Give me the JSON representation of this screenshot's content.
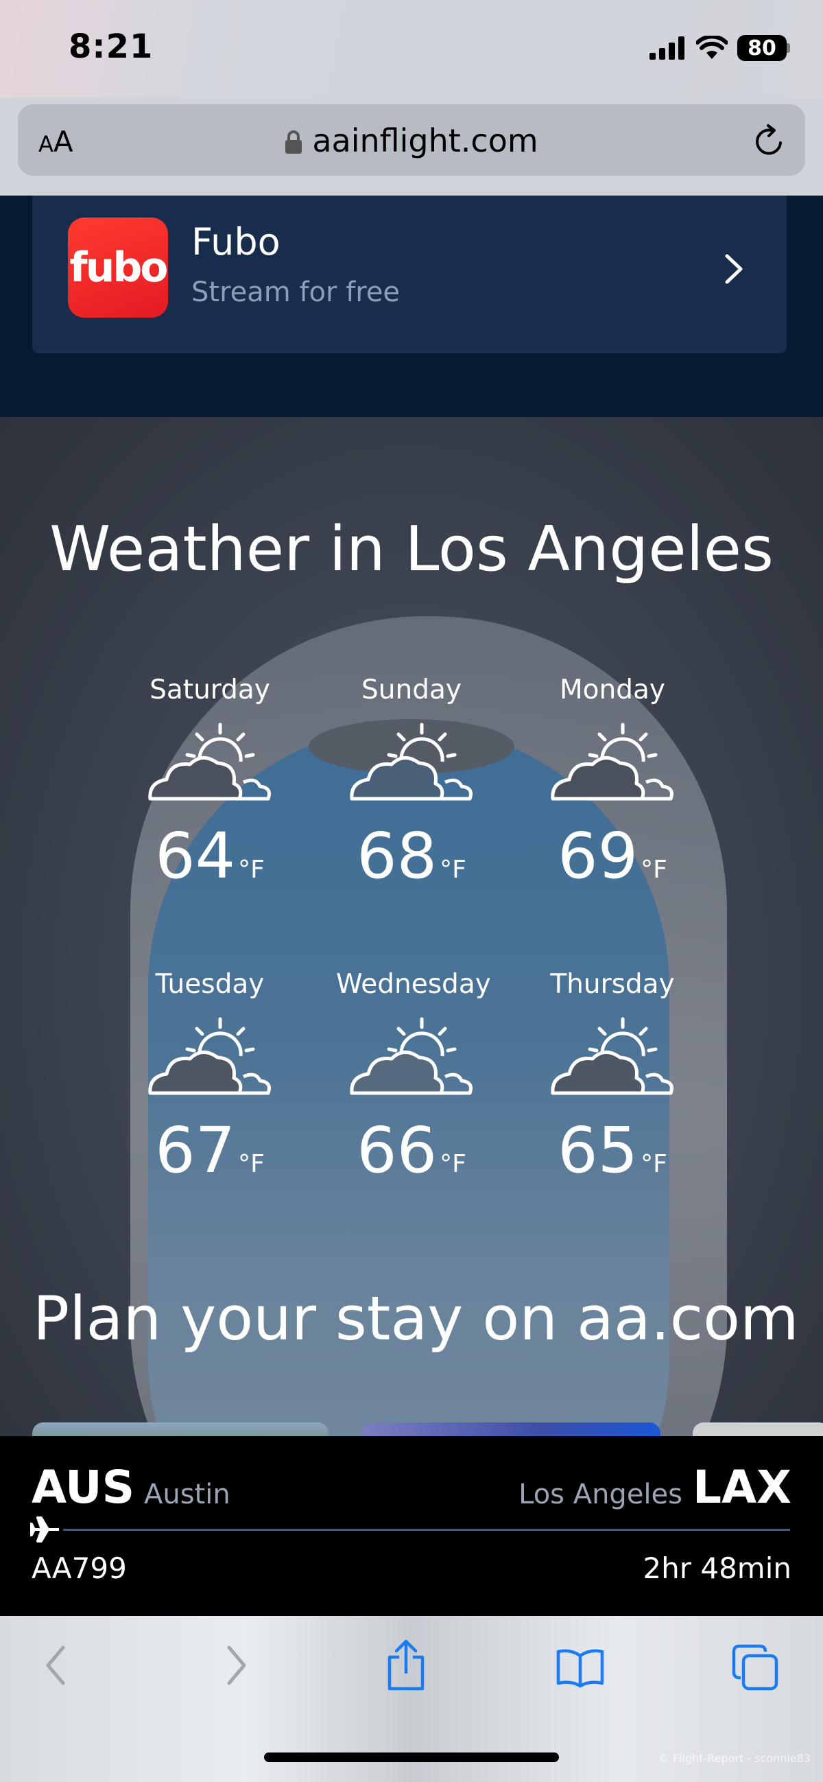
{
  "status_bar": {
    "time": "8:21",
    "battery": "80"
  },
  "url_bar": {
    "text_size_small": "A",
    "text_size_large": "A",
    "url": "aainflight.com"
  },
  "promo": {
    "logo_text": "fubo",
    "title": "Fubo",
    "subtitle": "Stream for free"
  },
  "weather": {
    "title": "Weather in Los Angeles",
    "unit": "°F",
    "days": [
      {
        "name": "Saturday",
        "temp": "64",
        "icon": "partly-cloudy-icon"
      },
      {
        "name": "Sunday",
        "temp": "68",
        "icon": "partly-cloudy-icon"
      },
      {
        "name": "Monday",
        "temp": "69",
        "icon": "partly-cloudy-icon"
      },
      {
        "name": "Tuesday",
        "temp": "67",
        "icon": "partly-cloudy-icon"
      },
      {
        "name": "Wednesday",
        "temp": "66",
        "icon": "partly-cloudy-icon"
      },
      {
        "name": "Thursday",
        "temp": "65",
        "icon": "partly-cloudy-icon"
      }
    ]
  },
  "plan": {
    "title": "Plan your stay on aa.com"
  },
  "flight": {
    "origin_code": "AUS",
    "origin_city": "Austin",
    "destination_city": "Los Angeles",
    "destination_code": "LAX",
    "flight_number": "AA799",
    "duration": "2hr 48min"
  },
  "toolbar": {
    "icons": [
      "back-icon",
      "forward-icon",
      "share-icon",
      "bookmarks-icon",
      "tabs-icon"
    ],
    "accent_color": "#1b7cf2"
  },
  "watermark": "© Flight-Report - sconnie83"
}
